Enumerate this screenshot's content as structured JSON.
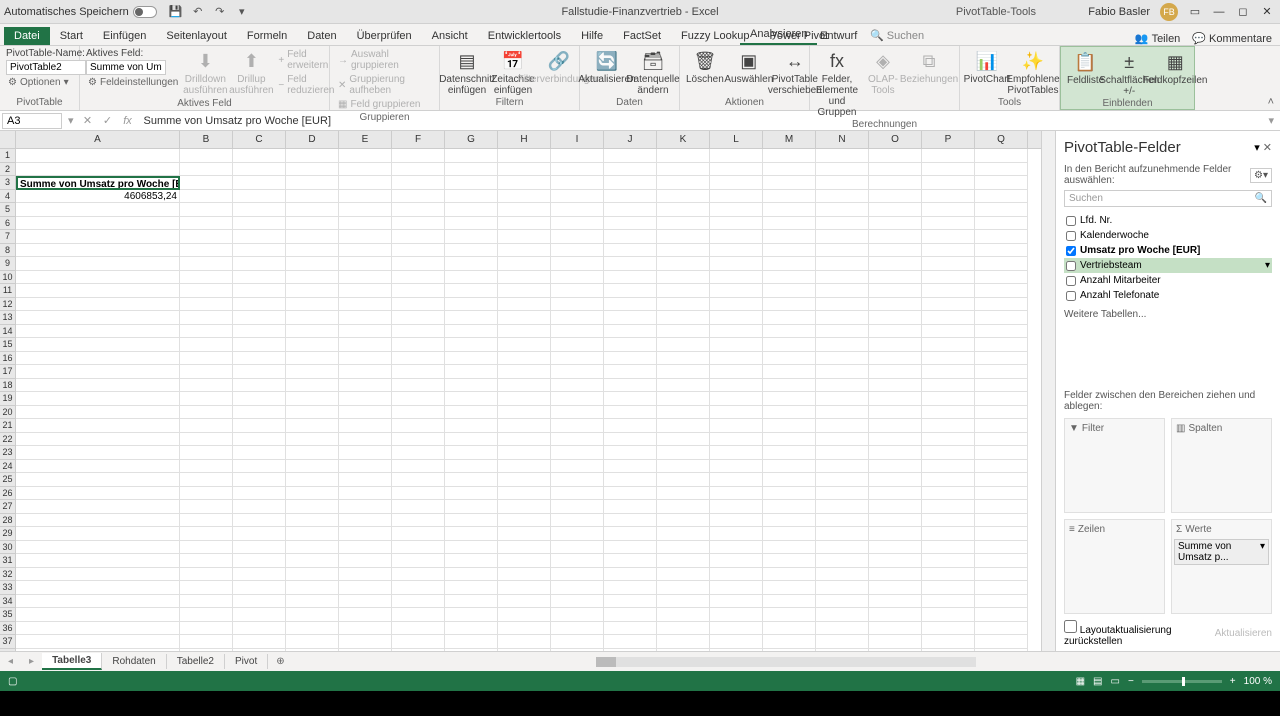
{
  "titlebar": {
    "auto_save": "Automatisches Speichern",
    "doc_title": "Fallstudie-Finanzvertrieb - Excel",
    "context_tool": "PivotTable-Tools",
    "user_name": "Fabio Basler",
    "user_initials": "FB"
  },
  "tabs": {
    "file": "Datei",
    "items": [
      "Start",
      "Einfügen",
      "Seitenlayout",
      "Formeln",
      "Daten",
      "Überprüfen",
      "Ansicht",
      "Entwicklertools",
      "Hilfe",
      "FactSet",
      "Fuzzy Lookup",
      "Power Pivot"
    ],
    "context": [
      "Analysieren",
      "Entwurf"
    ],
    "search": "Suchen",
    "share": "Teilen",
    "comments": "Kommentare"
  },
  "ribbon": {
    "pt_name_label": "PivotTable-Name:",
    "pt_name_value": "PivotTable2",
    "options": "Optionen",
    "group1": "PivotTable",
    "active_field_label": "Aktives Feld:",
    "active_field_value": "Summe von Ums",
    "field_settings": "Feldeinstellungen",
    "drilldown": "Drilldown ausführen",
    "drillup": "Drillup ausführen",
    "group2": "Aktives Feld",
    "sel_group": "Auswahl gruppieren",
    "ungroup": "Gruppierung aufheben",
    "field_group": "Feld gruppieren",
    "group3": "Gruppieren",
    "slicer": "Datenschnitt einfügen",
    "timeline": "Zeitachse einfügen",
    "filter_conn": "Filterverbindungen",
    "group4": "Filtern",
    "refresh": "Aktualisieren",
    "change_src": "Datenquelle ändern",
    "group5": "Daten",
    "clear": "Löschen",
    "select": "Auswählen",
    "move": "PivotTable verschieben",
    "group6": "Aktionen",
    "fields_items": "Felder, Elemente und Gruppen",
    "olap": "OLAP-Tools",
    "relations": "Beziehungen",
    "group7": "Berechnungen",
    "pivotchart": "PivotChart",
    "recommended": "Empfohlene PivotTables",
    "group8": "Tools",
    "fieldlist": "Feldliste",
    "buttons": "Schaltflächen +/-",
    "headers": "Feldkopfzeilen",
    "group9": "Einblenden",
    "expand": "Feld erweitern",
    "reduce": "Feld reduzieren"
  },
  "formula_bar": {
    "cell_ref": "A3",
    "formula": "Summe von Umsatz pro Woche [EUR]"
  },
  "grid": {
    "columns": [
      "A",
      "B",
      "C",
      "D",
      "E",
      "F",
      "G",
      "H",
      "I",
      "J",
      "K",
      "L",
      "M",
      "N",
      "O",
      "P",
      "Q"
    ],
    "a3": "Summe von Umsatz pro Woche [EUR]",
    "a4": "4606853,24"
  },
  "task_pane": {
    "title": "PivotTable-Felder",
    "subtitle": "In den Bericht aufzunehmende Felder auswählen:",
    "search_placeholder": "Suchen",
    "fields": [
      {
        "label": "Lfd. Nr.",
        "checked": false
      },
      {
        "label": "Kalenderwoche",
        "checked": false
      },
      {
        "label": "Umsatz pro Woche [EUR]",
        "checked": true
      },
      {
        "label": "Vertriebsteam",
        "checked": false,
        "hover": true
      },
      {
        "label": "Anzahl Mitarbeiter",
        "checked": false
      },
      {
        "label": "Anzahl Telefonate",
        "checked": false
      }
    ],
    "more_tables": "Weitere Tabellen...",
    "drag_label": "Felder zwischen den Bereichen ziehen und ablegen:",
    "filter": "Filter",
    "columns_area": "Spalten",
    "rows": "Zeilen",
    "values": "Werte",
    "value_chip": "Summe von Umsatz p...",
    "defer": "Layoutaktualisierung zurückstellen",
    "update": "Aktualisieren"
  },
  "sheet_tabs": [
    "Tabelle3",
    "Rohdaten",
    "Tabelle2",
    "Pivot"
  ],
  "statusbar": {
    "zoom": "100 %"
  }
}
